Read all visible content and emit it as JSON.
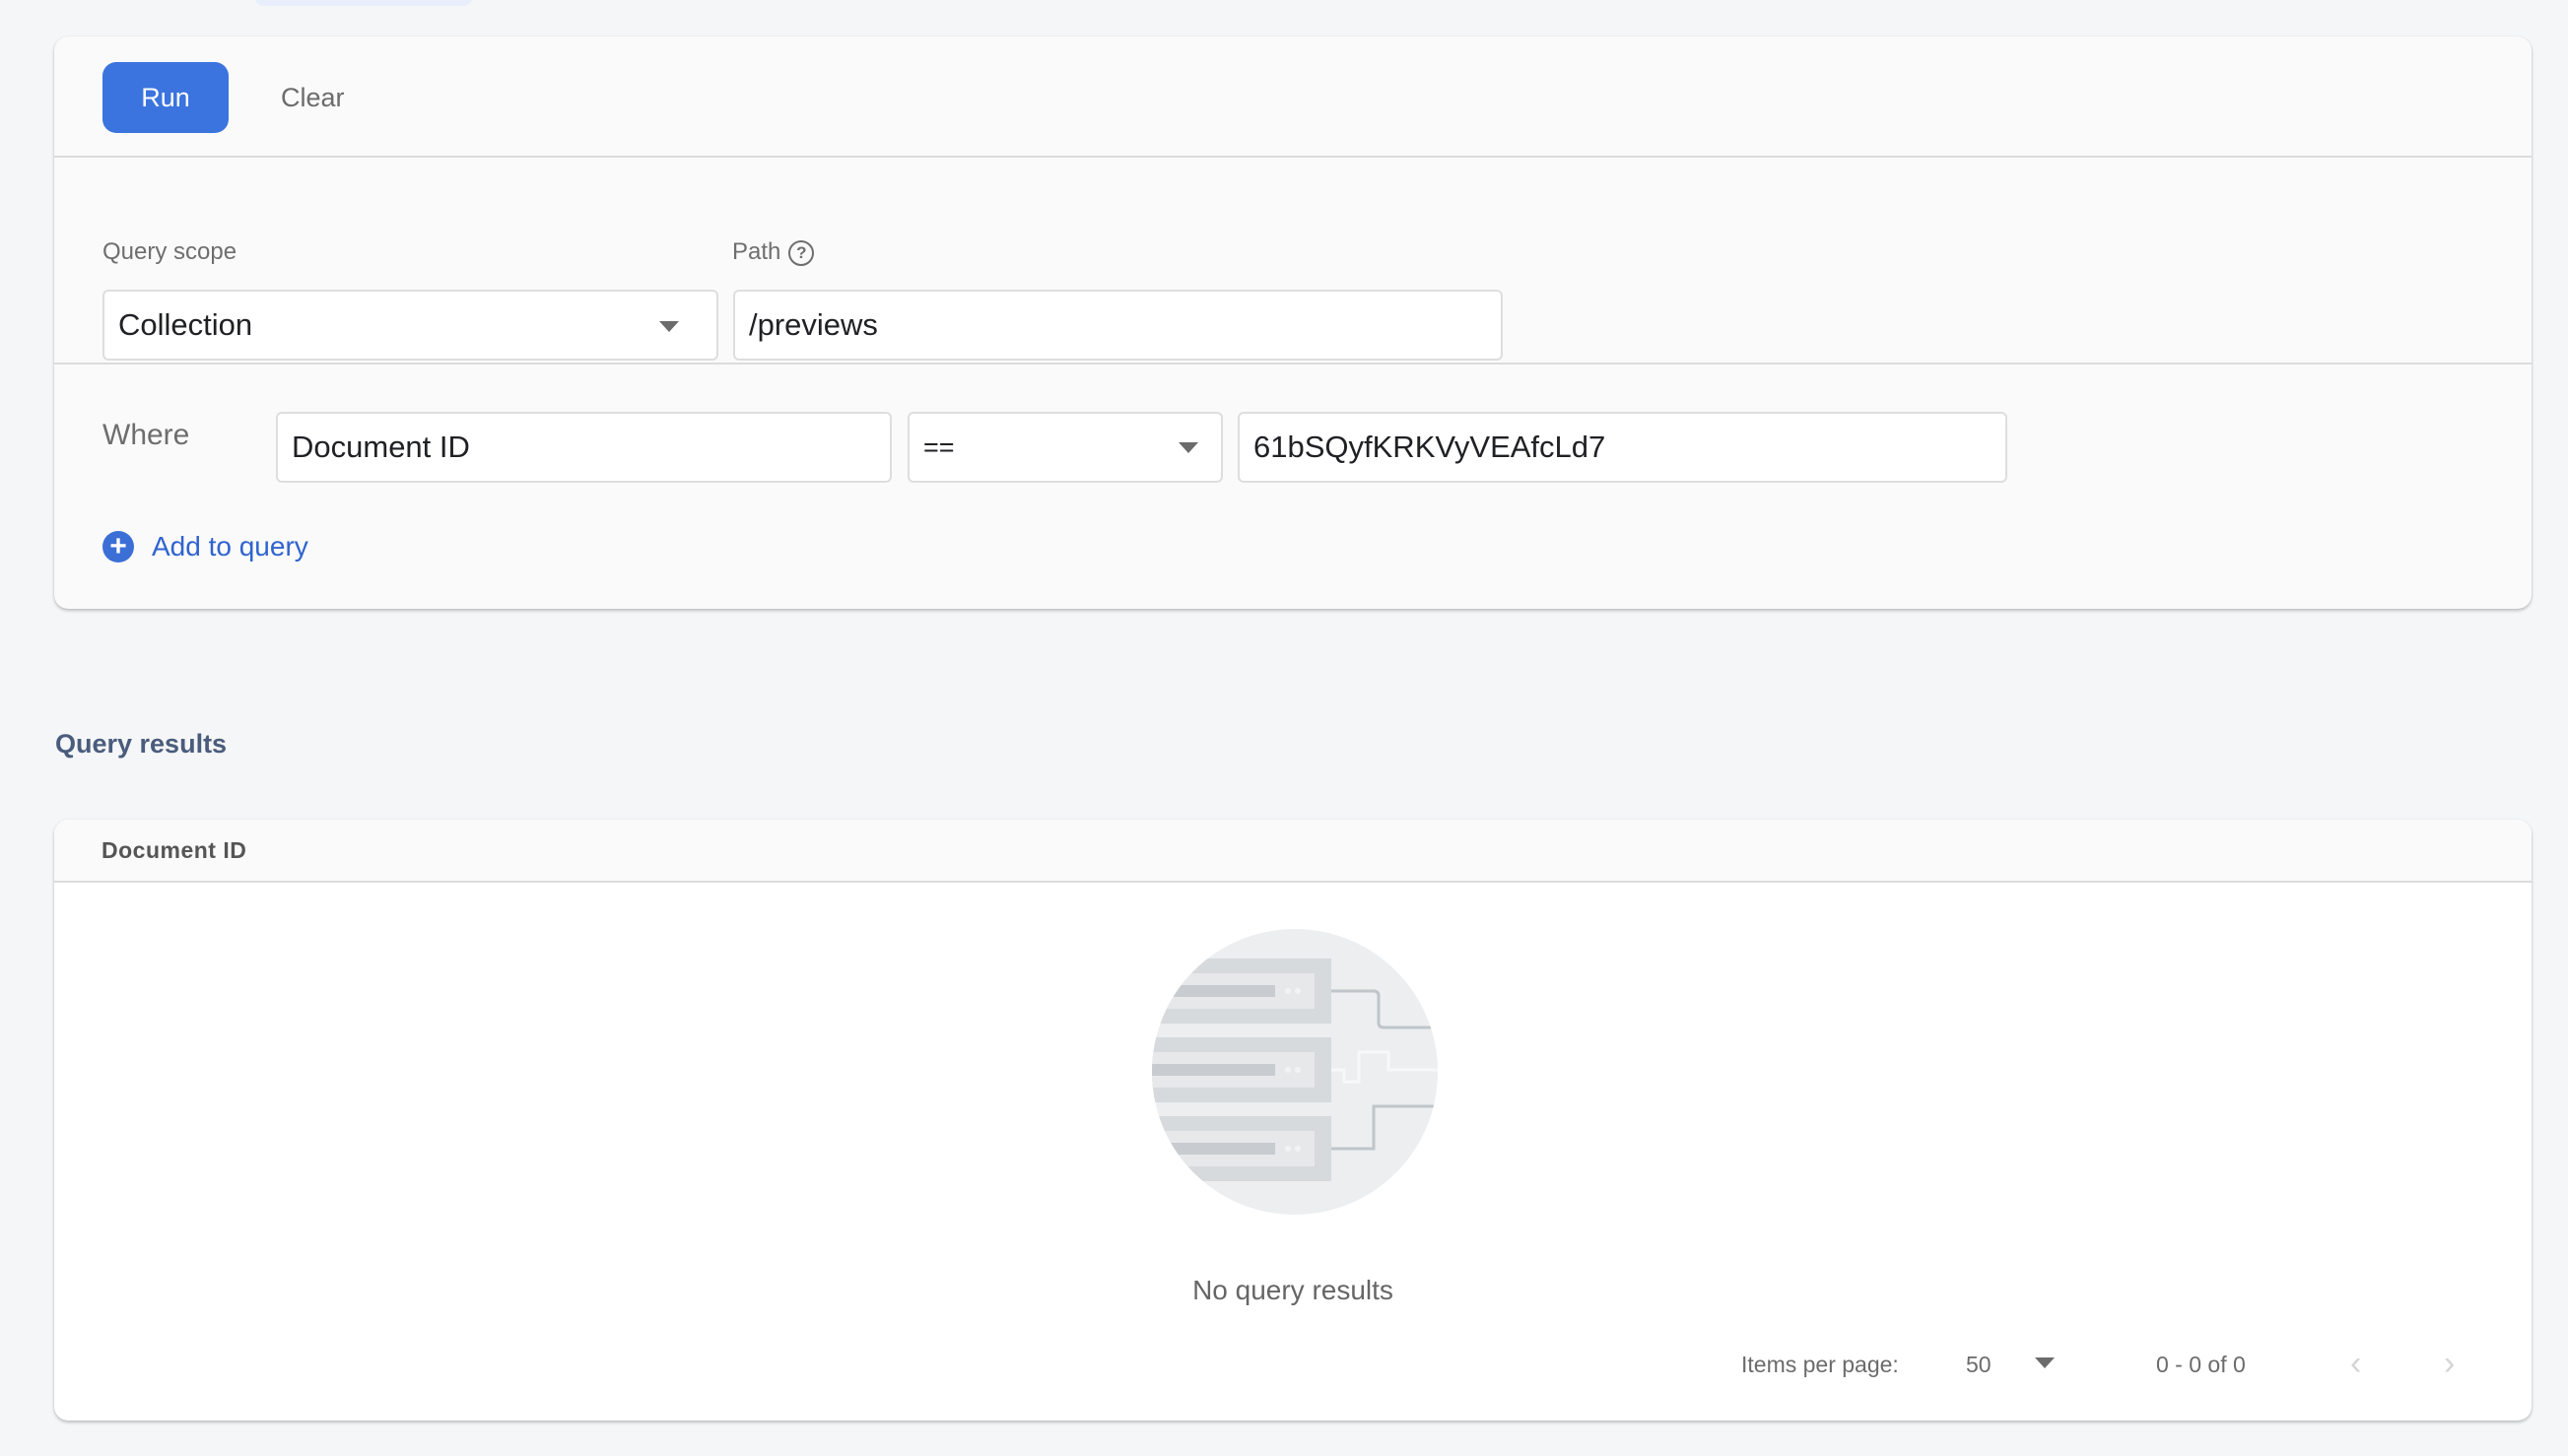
{
  "toolbar": {
    "run_label": "Run",
    "clear_label": "Clear"
  },
  "scope": {
    "label": "Query scope",
    "value": "Collection",
    "path_label": "Path",
    "path_value": "/previews"
  },
  "where": {
    "label": "Where",
    "field": "Document ID",
    "operator": "==",
    "value": "61bSQyfKRKVyVEAfcLd7",
    "add_label": "Add to query"
  },
  "results": {
    "title": "Query results",
    "columns": [
      "Document ID"
    ],
    "rows": [],
    "empty_message": "No query results",
    "pagination": {
      "items_per_page_label": "Items per page:",
      "items_per_page": "50",
      "range_text": "0 - 0 of 0"
    }
  },
  "icons": {
    "help": "?",
    "add": "+",
    "prev": "‹",
    "next": "›"
  },
  "colors": {
    "primary": "#3b74df",
    "link": "#2f63cf",
    "section_title": "#4a5c7c"
  }
}
